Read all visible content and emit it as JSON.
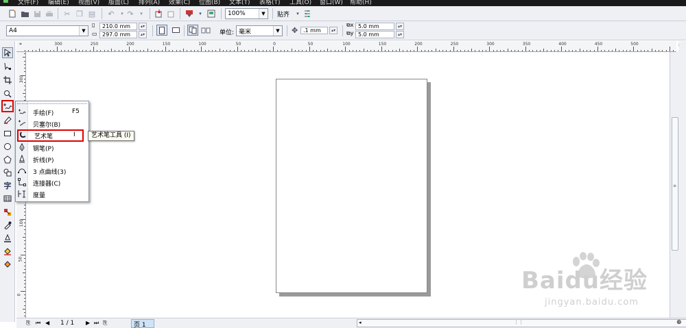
{
  "menu": {
    "items": [
      "文件(F)",
      "编辑(E)",
      "视图(V)",
      "版面(L)",
      "排列(A)",
      "效果(C)",
      "位图(B)",
      "文本(T)",
      "表格(T)",
      "工具(O)",
      "窗口(W)",
      "帮助(H)"
    ]
  },
  "toolbar": {
    "zoom_value": "100%",
    "snap_label": "贴齐"
  },
  "property_bar": {
    "page_size": "A4",
    "width": "210.0 mm",
    "height": "297.0 mm",
    "units_label": "单位:",
    "units_value": "毫米",
    "nudge": ".1 mm",
    "dup_x": "5.0 mm",
    "dup_y": "5.0 mm"
  },
  "ruler_h": {
    "labels": [
      "300",
      "250",
      "200",
      "150",
      "100",
      "50",
      "0",
      "50",
      "100",
      "150",
      "200",
      "250",
      "300",
      "350",
      "400",
      "450",
      "500"
    ],
    "unit": "毫米"
  },
  "ruler_v": {
    "labels": [
      "300",
      "250",
      "200",
      "150",
      "100",
      "50",
      "0"
    ]
  },
  "flyout": {
    "items": [
      {
        "label": "手绘(F)",
        "key": "F5",
        "icon": "freehand-icon"
      },
      {
        "label": "贝塞尔(B)",
        "key": "",
        "icon": "bezier-icon"
      },
      {
        "label": "艺术笔",
        "key": "I",
        "icon": "artistic-media-icon"
      },
      {
        "label": "钢笔(P)",
        "key": "",
        "icon": "pen-icon"
      },
      {
        "label": "折线(P)",
        "key": "",
        "icon": "polyline-icon"
      },
      {
        "label": "3 点曲线(3)",
        "key": "",
        "icon": "three-point-curve-icon"
      },
      {
        "label": "连接器(C)",
        "key": "",
        "icon": "connector-icon"
      },
      {
        "label": "度量",
        "key": "",
        "icon": "dimension-icon"
      }
    ],
    "highlighted_index": 2
  },
  "tooltip": {
    "text": "艺术笔工具 (I)"
  },
  "status": {
    "page_count": "1 / 1",
    "page_tab": "页 1"
  },
  "watermark": {
    "logo": "Baidu经验",
    "url": "jingyan.baidu.com"
  },
  "colors": {
    "highlight": "#e00000",
    "bar_bg": "#eef0f4"
  }
}
